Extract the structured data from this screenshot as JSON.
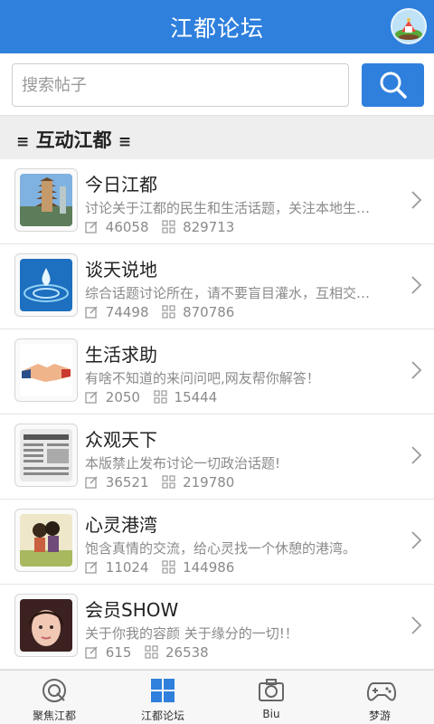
{
  "header": {
    "title": "江都论坛"
  },
  "search": {
    "placeholder": "搜索帖子",
    "value": ""
  },
  "section": {
    "title": "互动江都",
    "menu_glyph": "≡"
  },
  "forums": [
    {
      "title": "今日江都",
      "description": "讨论关于江都的民生和生活话题，关注本地生…",
      "posts": "46058",
      "replies": "829713",
      "thumb": "pagoda"
    },
    {
      "title": "谈天说地",
      "description": "综合话题讨论所在，请不要盲目灌水，互相交…",
      "posts": "74498",
      "replies": "870786",
      "thumb": "water-drop"
    },
    {
      "title": "生活求助",
      "description": "有啥不知道的来问问吧,网友帮你解答！",
      "posts": "2050",
      "replies": "15444",
      "thumb": "handshake"
    },
    {
      "title": "众观天下",
      "description": "本版禁止发布讨论一切政治话题!",
      "posts": "36521",
      "replies": "219780",
      "thumb": "newspaper"
    },
    {
      "title": "心灵港湾",
      "description": "饱含真情的交流，给心灵找一个休憩的港湾。",
      "posts": "11024",
      "replies": "144986",
      "thumb": "couple"
    },
    {
      "title": "会员SHOW",
      "description": "关于你我的容颜 关于缘分的一切!！",
      "posts": "615",
      "replies": "26538",
      "thumb": "portrait"
    }
  ],
  "tabs": [
    {
      "label": "聚焦江都",
      "icon": "focus-icon",
      "active": false
    },
    {
      "label": "江都论坛",
      "icon": "grid-icon",
      "active": true
    },
    {
      "label": "Biu",
      "icon": "camera-icon",
      "active": false
    },
    {
      "label": "梦游",
      "icon": "gamepad-icon",
      "active": false
    }
  ],
  "colors": {
    "primary": "#2f80dd",
    "section_bg": "#eeeeee",
    "text": "#222222",
    "muted": "#8a8a8a"
  }
}
